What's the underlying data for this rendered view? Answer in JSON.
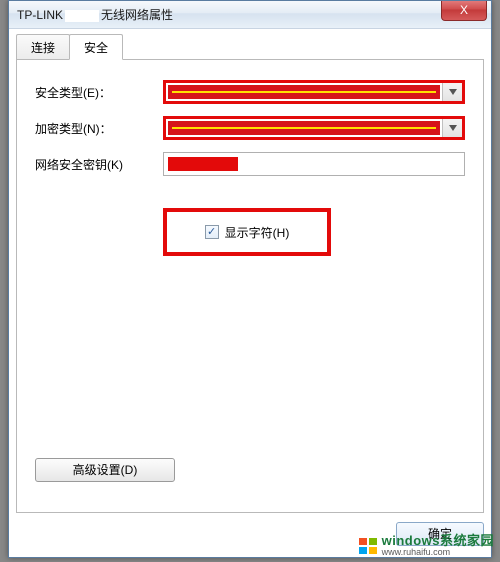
{
  "window": {
    "title_prefix": "TP-LINK",
    "title_suffix": "无线网络属性",
    "close_label": "X"
  },
  "tabs": {
    "t0": {
      "label": "连接"
    },
    "t1": {
      "label": "安全"
    }
  },
  "form": {
    "security_type_label": "安全类型(E)：",
    "encryption_type_label": "加密类型(N)：",
    "network_key_label": "网络安全密钥(K)",
    "show_chars_label": "显示字符(H)",
    "show_chars_checked": "✓"
  },
  "buttons": {
    "advanced": "高级设置(D)",
    "ok": "确定"
  },
  "watermark": {
    "main": "windows系统家园",
    "sub": "www.ruhaifu.com"
  }
}
